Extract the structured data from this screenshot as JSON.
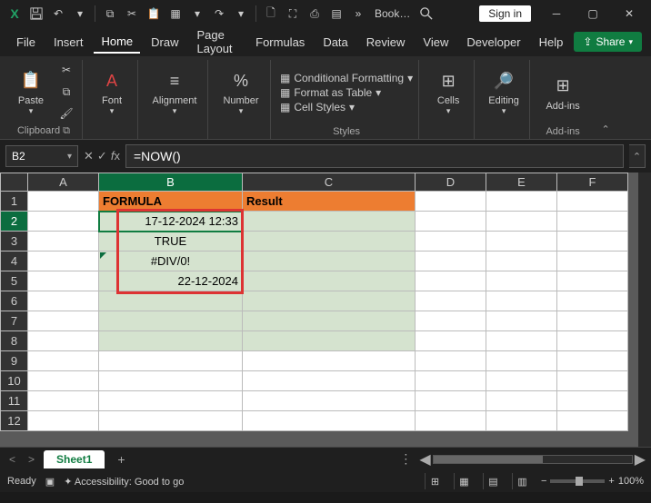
{
  "titlebar": {
    "title": "Book…",
    "signin": "Sign in"
  },
  "tabs": {
    "items": [
      "File",
      "Insert",
      "Home",
      "Draw",
      "Page Layout",
      "Formulas",
      "Data",
      "Review",
      "View",
      "Developer",
      "Help"
    ],
    "active": "Home",
    "share": "Share"
  },
  "ribbon": {
    "clipboard": {
      "paste": "Paste",
      "label": "Clipboard"
    },
    "font": {
      "label": "Font"
    },
    "alignment": {
      "label": "Alignment"
    },
    "number": {
      "label": "Number"
    },
    "styles": {
      "cond": "Conditional Formatting",
      "table": "Format as Table",
      "cell": "Cell Styles",
      "label": "Styles"
    },
    "cells": {
      "label": "Cells"
    },
    "editing": {
      "label": "Editing"
    },
    "addins": {
      "btn": "Add-ins",
      "label": "Add-ins"
    }
  },
  "formula_bar": {
    "name_box": "B2",
    "formula": "=NOW()"
  },
  "grid": {
    "columns": [
      "A",
      "B",
      "C",
      "D",
      "E",
      "F"
    ],
    "rows": [
      "1",
      "2",
      "3",
      "4",
      "5",
      "6",
      "7",
      "8",
      "9",
      "10",
      "11",
      "12"
    ],
    "headers": {
      "b1": "FORMULA",
      "c1": "Result"
    },
    "b2": "17-12-2024 12:33",
    "b3": "TRUE",
    "b4": "#DIV/0!",
    "b5": "22-12-2024"
  },
  "sheets": {
    "active": "Sheet1"
  },
  "status": {
    "ready": "Ready",
    "access": "Accessibility: Good to go",
    "zoom": "100%"
  },
  "chart_data": {
    "type": "table",
    "note": "Spreadsheet cells shown in screenshot",
    "columns": [
      "FORMULA",
      "Result"
    ],
    "rows": [
      [
        "17-12-2024 12:33",
        ""
      ],
      [
        "TRUE",
        ""
      ],
      [
        "#DIV/0!",
        ""
      ],
      [
        "22-12-2024",
        ""
      ]
    ],
    "selected_cell": "B2",
    "selected_formula": "=NOW()"
  }
}
